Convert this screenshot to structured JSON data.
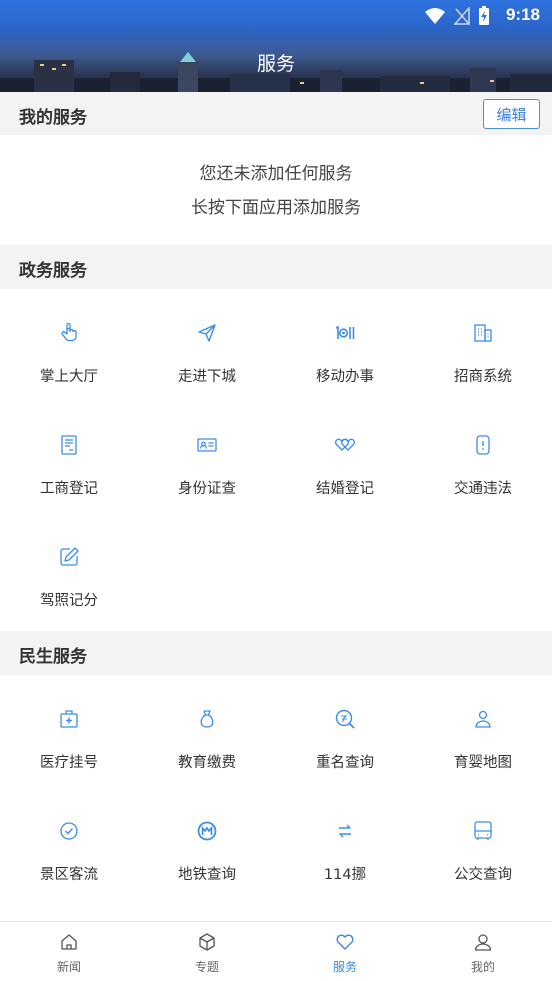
{
  "status_bar": {
    "time": "9:18"
  },
  "header": {
    "title": "服务"
  },
  "my_services": {
    "title": "我的服务",
    "edit_label": "编辑",
    "empty_line1": "您还未添加任何服务",
    "empty_line2": "长按下面应用添加服务"
  },
  "gov_services": {
    "title": "政务服务",
    "items": [
      {
        "label": "掌上大厅",
        "icon": "hand-tap-icon"
      },
      {
        "label": "走进下城",
        "icon": "paper-plane-icon"
      },
      {
        "label": "移动办事",
        "icon": "mobile-service-icon"
      },
      {
        "label": "招商系统",
        "icon": "building-icon"
      },
      {
        "label": "工商登记",
        "icon": "form-document-icon"
      },
      {
        "label": "身份证查",
        "icon": "id-card-icon"
      },
      {
        "label": "结婚登记",
        "icon": "hearts-icon"
      },
      {
        "label": "交通违法",
        "icon": "traffic-alert-icon"
      },
      {
        "label": "驾照记分",
        "icon": "edit-pen-icon"
      }
    ]
  },
  "life_services": {
    "title": "民生服务",
    "items": [
      {
        "label": "医疗挂号",
        "icon": "medical-kit-icon"
      },
      {
        "label": "教育缴费",
        "icon": "money-bag-icon"
      },
      {
        "label": "重名查询",
        "icon": "name-search-icon"
      },
      {
        "label": "育婴地图",
        "icon": "baby-person-icon"
      },
      {
        "label": "景区客流",
        "icon": "shield-check-icon"
      },
      {
        "label": "地铁查询",
        "icon": "metro-icon"
      },
      {
        "label": "114挪",
        "icon": "swap-arrows-icon"
      },
      {
        "label": "公交查询",
        "icon": "bus-icon"
      }
    ]
  },
  "tabbar": {
    "items": [
      {
        "label": "新闻",
        "icon": "home-icon",
        "active": false
      },
      {
        "label": "专题",
        "icon": "cube-icon",
        "active": false
      },
      {
        "label": "服务",
        "icon": "heart-icon",
        "active": true
      },
      {
        "label": "我的",
        "icon": "user-icon",
        "active": false
      }
    ]
  },
  "colors": {
    "accent": "#3a86e0",
    "icon_blue": "#3b8ee6",
    "header_top": "#2f73e0"
  }
}
